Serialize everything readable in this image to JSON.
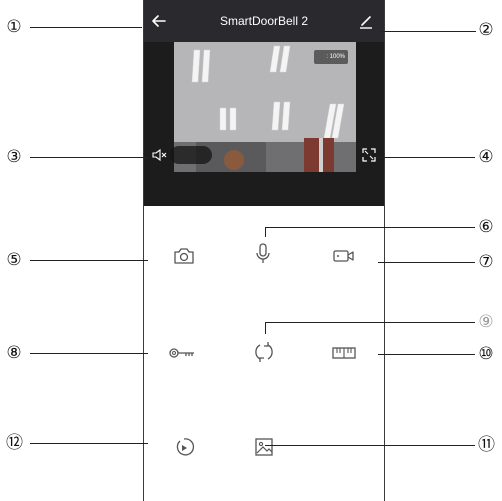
{
  "header": {
    "title": "SmartDoorBell 2"
  },
  "video": {
    "zoom_label": ": 100%"
  },
  "icons": {
    "back": "back-arrow-icon",
    "edit": "pencil-icon",
    "mute": "speaker-mute-icon",
    "fullscreen": "fullscreen-icon",
    "snapshot": "camera-icon",
    "talk": "microphone-icon",
    "record": "video-camera-icon",
    "unlock": "key-icon",
    "rotate": "rotate-icon",
    "quality": "hd-icon",
    "playback": "playback-icon",
    "gallery": "image-icon"
  },
  "callouts": [
    "①",
    "②",
    "③",
    "④",
    "⑤",
    "⑥",
    "⑦",
    "⑧",
    "⑨",
    "⑩",
    "⑪",
    "⑫"
  ],
  "colors": {
    "topbar": "#2a2a2e",
    "video_bg": "#1c1c1c",
    "icon": "#555555"
  }
}
